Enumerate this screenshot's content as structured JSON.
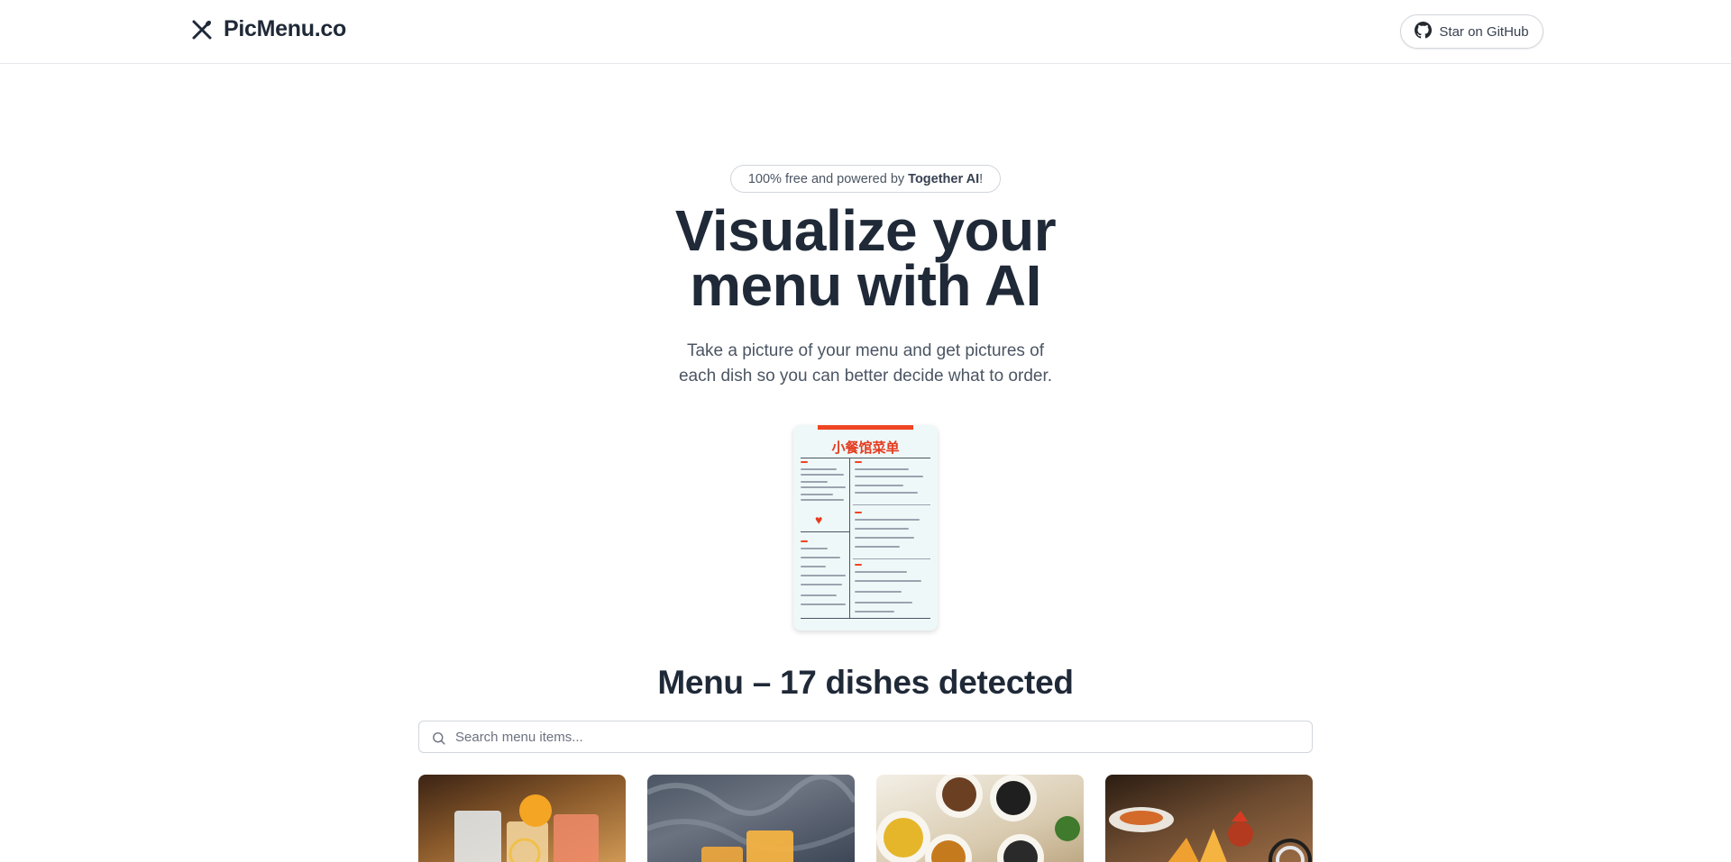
{
  "header": {
    "logo_text": "PicMenu.co",
    "github_label": "Star on GitHub"
  },
  "hero": {
    "badge_prefix": "100% free and powered by ",
    "badge_brand": "Together AI",
    "badge_suffix": "!",
    "title_line1": "Visualize your",
    "title_line2": "menu with AI",
    "subtitle_line1": "Take a picture of your menu and get pictures of",
    "subtitle_line2": "each dish so you can better decide what to order."
  },
  "uploaded_menu": {
    "title": "小餐馆菜单"
  },
  "results": {
    "heading": "Menu – 17 dishes detected",
    "search_placeholder": "Search menu items..."
  },
  "icons": {
    "logo": "utensils-icon",
    "github": "github-icon",
    "search": "search-icon"
  },
  "colors": {
    "menu_accent": "#e53b1f",
    "text_dark": "#1f2937",
    "text_muted": "#4b5563"
  }
}
